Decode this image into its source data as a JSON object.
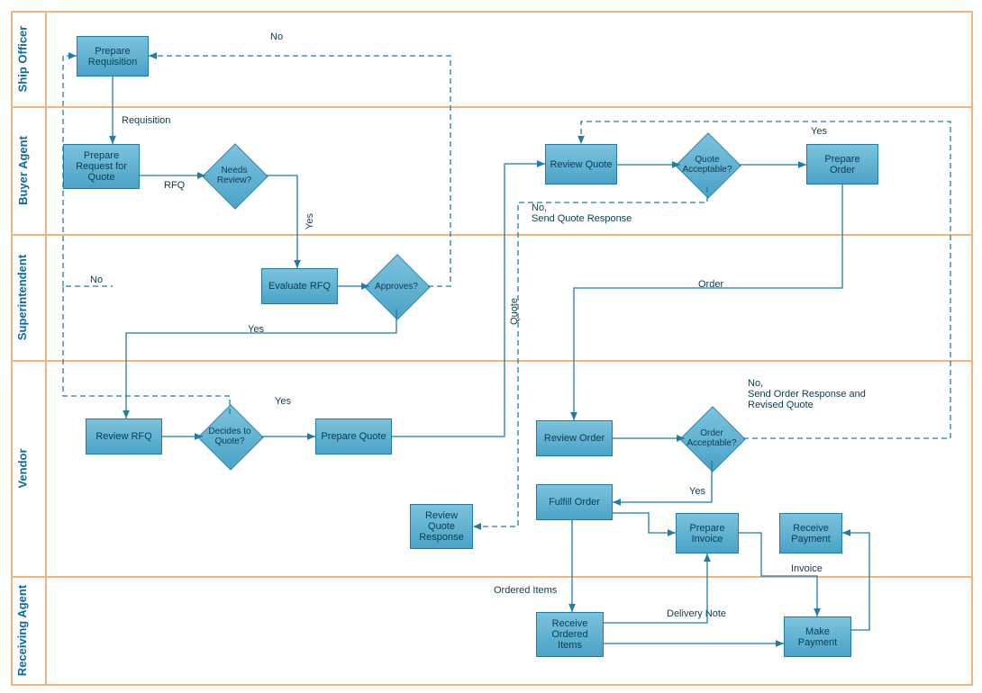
{
  "lanes": {
    "ship_officer": "Ship Officer",
    "buyer_agent": "Buyer Agent",
    "superintendent": "Superintendent",
    "vendor": "Vendor",
    "receiving_agent": "Receiving Agent"
  },
  "nodes": {
    "prepare_requisition": "Prepare Requisition",
    "prepare_rfq": "Prepare Request for Quote",
    "needs_review": "Needs Review?",
    "evaluate_rfq": "Evaluate RFQ",
    "approves": "Approves?",
    "review_rfq": "Review RFQ",
    "decides_to_quote": "Decides to Quote?",
    "prepare_quote": "Prepare Quote",
    "review_quote_response": "Review Quote Response",
    "review_quote": "Review Quote",
    "quote_acceptable": "Quote Acceptable?",
    "prepare_order": "Prepare Order",
    "review_order": "Review Order",
    "order_acceptable": "Order Acceptable?",
    "fulfill_order": "Fulfill Order",
    "prepare_invoice": "Prepare Invoice",
    "receive_payment": "Receive Payment",
    "receive_ordered_items": "Receive Ordered Items",
    "make_payment": "Make Payment"
  },
  "edge_labels": {
    "no1": "No",
    "requisition": "Requisition",
    "rfq": "RFQ",
    "yes1": "Yes",
    "no2": "No",
    "yes2": "Yes",
    "yes3": "Yes",
    "quote": "Quote",
    "no_send_quote": "No,\nSend Quote Response",
    "yes4": "Yes",
    "order": "Order",
    "no_send_order": "No,\nSend Order Response and\nRevised Quote",
    "yes5": "Yes",
    "ordered_items": "Ordered Items",
    "delivery_note": "Delivery Note",
    "invoice": "Invoice"
  }
}
